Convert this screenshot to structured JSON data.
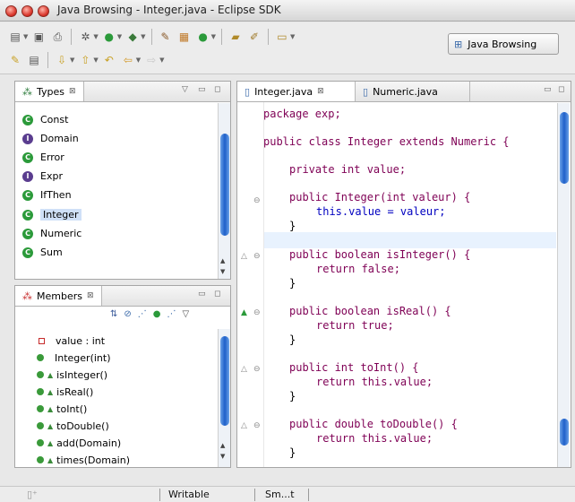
{
  "window": {
    "title": "Java Browsing - Integer.java - Eclipse SDK"
  },
  "toolbar": {
    "perspective_label": "Java Browsing"
  },
  "types_view": {
    "tab_label": "Types",
    "items": [
      {
        "label": "Const",
        "kind": "class"
      },
      {
        "label": "Domain",
        "kind": "interface"
      },
      {
        "label": "Error",
        "kind": "class"
      },
      {
        "label": "Expr",
        "kind": "interface"
      },
      {
        "label": "IfThen",
        "kind": "class"
      },
      {
        "label": "Integer",
        "kind": "class",
        "selected": true
      },
      {
        "label": "Numeric",
        "kind": "abstract-class"
      },
      {
        "label": "Sum",
        "kind": "class"
      }
    ]
  },
  "members_view": {
    "tab_label": "Members",
    "items": [
      {
        "label": "value : int",
        "kind": "private-field"
      },
      {
        "label": "Integer(int)",
        "kind": "constructor"
      },
      {
        "label": "isInteger()",
        "kind": "override-method"
      },
      {
        "label": "isReal()",
        "kind": "override-method"
      },
      {
        "label": "toInt()",
        "kind": "override-method"
      },
      {
        "label": "toDouble()",
        "kind": "override-method"
      },
      {
        "label": "add(Domain)",
        "kind": "override-method"
      },
      {
        "label": "times(Domain)",
        "kind": "override-method"
      }
    ]
  },
  "editor": {
    "tabs": [
      {
        "label": "Integer.java",
        "active": true
      },
      {
        "label": "Numeric.java",
        "active": false
      }
    ],
    "code": {
      "l1": "package exp;",
      "l2": "public class Integer extends Numeric {",
      "l3": "private int value;",
      "l4": "public Integer(int valeur) {",
      "l5": "this.value = valeur;",
      "l6": "}",
      "l7": "public boolean isInteger() {",
      "l8": "return false;",
      "l9": "}",
      "l10": "public boolean isReal() {",
      "l11": "return true;",
      "l12": "}",
      "l13": "public int toInt() {",
      "l14": "return this.value;",
      "l15": "}",
      "l16": "public double toDouble() {",
      "l17": "return this.value;",
      "l18": "}"
    }
  },
  "status": {
    "mode": "Writable",
    "insert": "Sm...t"
  },
  "colors": {
    "keyword": "#7f0055",
    "field": "#0000c0",
    "selection": "#cfe0f7",
    "current_line": "#e8f2fe"
  }
}
